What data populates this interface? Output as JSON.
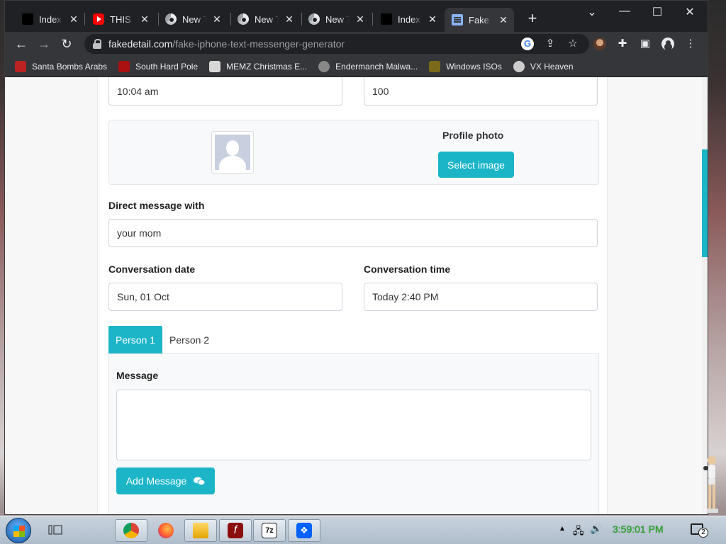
{
  "browser": {
    "tabs": [
      {
        "title": "Index of",
        "icon": "folder-black"
      },
      {
        "title": "THIS IS",
        "icon": "youtube"
      },
      {
        "title": "New Tab",
        "icon": "chrome"
      },
      {
        "title": "New Tab",
        "icon": "chrome"
      },
      {
        "title": "New Tab",
        "icon": "chrome"
      },
      {
        "title": "Index of",
        "icon": "folder-black"
      },
      {
        "title": "Fake iPhone",
        "icon": "doc",
        "active": true
      }
    ],
    "new_tab": "+",
    "window_controls": {
      "dropdown": "⌄",
      "minimize": "—",
      "maximize": "☐",
      "close": "✕"
    },
    "url_host": "fakedetail.com",
    "url_path": "/fake-iphone-text-messenger-generator",
    "bookmarks": [
      {
        "label": "Santa Bombs Arabs"
      },
      {
        "label": "South Hard Pole"
      },
      {
        "label": "MEMZ Christmas E..."
      },
      {
        "label": "Endermanch Malwa..."
      },
      {
        "label": "Windows ISOs"
      },
      {
        "label": "VX Heaven"
      }
    ]
  },
  "form": {
    "top_left_value": "10:04 am",
    "top_right_value": "100",
    "profile_photo_label": "Profile photo",
    "select_image_label": "Select image",
    "direct_message_label": "Direct message with",
    "direct_message_value": "your mom",
    "conversation_date_label": "Conversation date",
    "conversation_date_value": "Sun, 01 Oct",
    "conversation_time_label": "Conversation time",
    "conversation_time_value": "Today 2:40 PM",
    "person_tabs": [
      "Person 1",
      "Person 2"
    ],
    "message_label": "Message",
    "message_value": "",
    "add_message_label": "Add Message"
  },
  "taskbar": {
    "clock": "3:59:01 PM",
    "notification_count": "2"
  },
  "colors": {
    "accent": "#1cb5c8",
    "clock": "#2fae2f"
  }
}
